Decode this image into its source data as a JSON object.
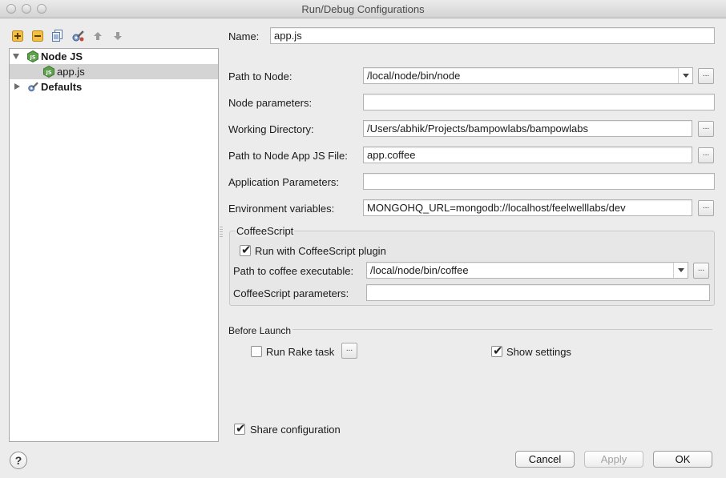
{
  "window": {
    "title": "Run/Debug Configurations"
  },
  "toolbar": {
    "icons": [
      "add-icon",
      "remove-icon",
      "copy-icon",
      "edit-defaults-icon",
      "move-up-icon",
      "move-down-icon"
    ]
  },
  "tree": {
    "items": [
      {
        "label": "Node JS",
        "expanded": true
      },
      {
        "label": "app.js",
        "selected": true
      },
      {
        "label": "Defaults",
        "expanded": false
      }
    ]
  },
  "form": {
    "name_label": "Name:",
    "name_value": "app.js",
    "path_to_node_label": "Path to Node:",
    "path_to_node_value": "/local/node/bin/node",
    "node_params_label": "Node parameters:",
    "node_params_value": "",
    "working_dir_label": "Working Directory:",
    "working_dir_value": "/Users/abhik/Projects/bampowlabs/bampowlabs",
    "app_js_label": "Path to Node App JS File:",
    "app_js_value": "app.coffee",
    "app_params_label": "Application Parameters:",
    "app_params_value": "",
    "env_vars_label": "Environment variables:",
    "env_vars_value": "MONGOHQ_URL=mongodb://localhost/feelwelllabs/dev",
    "browse": "..."
  },
  "coffeescript": {
    "legend": "CoffeeScript",
    "run_plugin_label": "Run with CoffeeScript plugin",
    "run_plugin_checked": true,
    "exec_label": "Path to coffee executable:",
    "exec_value": "/local/node/bin/coffee",
    "params_label": "CoffeeScript parameters:",
    "params_value": ""
  },
  "before_launch": {
    "heading": "Before Launch",
    "rake_label": "Run Rake task",
    "rake_checked": false,
    "show_settings_label": "Show settings",
    "show_settings_checked": true
  },
  "share": {
    "label": "Share configuration",
    "checked": true
  },
  "buttons": {
    "help": "?",
    "cancel": "Cancel",
    "apply": "Apply",
    "ok": "OK"
  },
  "colors": {
    "node_green": "#5fa04e",
    "selection": "#d4d4d4"
  }
}
